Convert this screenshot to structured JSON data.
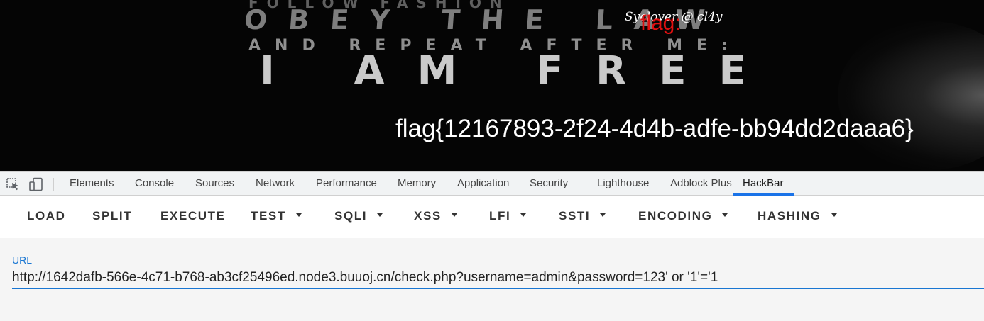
{
  "page": {
    "banner_lines": [
      "FOLLOW FASHION",
      "OBEY THE LAW",
      "AND REPEAT AFTER ME:",
      "I AM FREE"
    ],
    "brand": "Syclover @ cl4y",
    "flag_label": "flag:",
    "flag_value": "flag{12167893-2f24-4d4b-adfe-bb94dd2daaa6}"
  },
  "devtools": {
    "tabs": [
      {
        "label": "Elements"
      },
      {
        "label": "Console"
      },
      {
        "label": "Sources"
      },
      {
        "label": "Network"
      },
      {
        "label": "Performance"
      },
      {
        "label": "Memory"
      },
      {
        "label": "Application"
      },
      {
        "label": "Security"
      },
      {
        "label": "Lighthouse"
      },
      {
        "label": "Adblock Plus"
      },
      {
        "label": "HackBar"
      }
    ],
    "active_tab": "HackBar",
    "icons": [
      "inspect-element-icon",
      "device-toolbar-icon"
    ]
  },
  "hackbar": {
    "buttons": [
      {
        "label": "LOAD"
      },
      {
        "label": "SPLIT"
      },
      {
        "label": "EXECUTE"
      },
      {
        "label": "TEST"
      },
      {
        "label": "SQLI"
      },
      {
        "label": "XSS"
      },
      {
        "label": "LFI"
      },
      {
        "label": "SSTI"
      },
      {
        "label": "ENCODING"
      },
      {
        "label": "HASHING"
      }
    ],
    "url_label": "URL",
    "url_value": "http://1642dafb-566e-4c71-b768-ab3cf25496ed.node3.buuoj.cn/check.php?username=admin&password=123' or '1'='1"
  },
  "colors": {
    "accent": "#1976d2",
    "tab_indicator": "#1a73e8",
    "flag_red": "#e01010"
  }
}
